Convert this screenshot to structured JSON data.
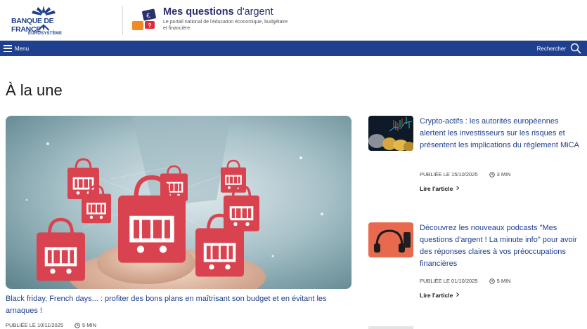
{
  "header": {
    "bdf_brand": "BANQUE DE FRANCE",
    "bdf_sub": "EUROSYSTÈME",
    "site_title_strong": "Mes questions",
    "site_title_light": "d'argent",
    "site_tagline": "Le portail national de l'éducation économique, budgétaire et financière",
    "logo_icon_symbols": [
      "€",
      "?"
    ]
  },
  "nav": {
    "menu_label": "Menu",
    "search_label": "Rechercher"
  },
  "main": {
    "section_title": "À la une",
    "hero": {
      "title": "Black friday, French days... : profiter des bons plans en maîtrisant son budget et en évitant les arnaques !",
      "date": "PUBLIÉE LE 10/11/2025",
      "read_time": "5 MIN"
    },
    "articles": [
      {
        "title": "Crypto-actifs : les autorités européennes alertent les investisseurs sur les risques et présentent les implications du règlement MiCA",
        "date": "PUBLIÉE LE 15/10/2025",
        "read_time": "3 MIN",
        "link": "Lire l'article"
      },
      {
        "title": "Découvrez les nouveaux podcasts \"Mes questions d'argent ! La minute info\" pour avoir des réponses claires à vos préoccupations financières",
        "date": "PUBLIÉE LE 01/10/2025",
        "read_time": "5 MIN",
        "link": "Lire l'article"
      }
    ]
  },
  "colors": {
    "brand_blue": "#1f3f8f",
    "link_blue": "#1f3f8f",
    "accent_orange": "#f08a24",
    "accent_red": "#d92e3a",
    "bag_red": "#d9434f"
  },
  "icons": [
    "menu-icon",
    "search-icon",
    "clock-icon",
    "chevron-right-icon"
  ]
}
